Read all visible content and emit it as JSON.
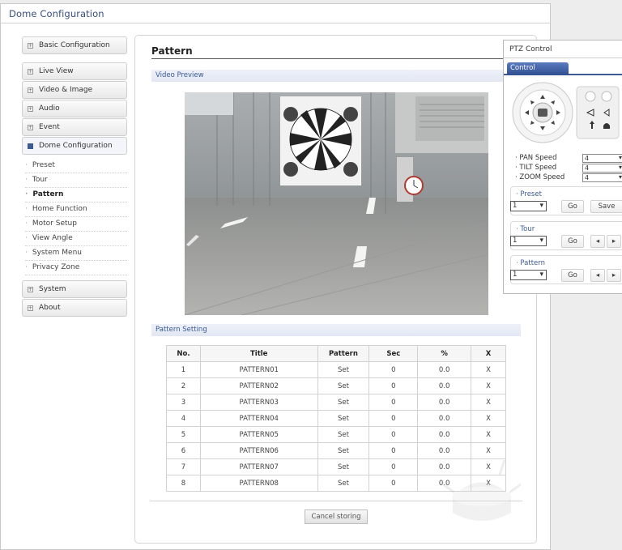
{
  "header": {
    "title": "Dome Configuration"
  },
  "sidebar": {
    "top_items": [
      {
        "label": "Basic Configuration"
      }
    ],
    "items": [
      {
        "label": "Live View"
      },
      {
        "label": "Video & Image"
      },
      {
        "label": "Audio"
      },
      {
        "label": "Event"
      },
      {
        "label": "Dome Configuration"
      }
    ],
    "submenu": [
      {
        "label": "Preset"
      },
      {
        "label": "Tour"
      },
      {
        "label": "Pattern"
      },
      {
        "label": "Home Function"
      },
      {
        "label": "Motor Setup"
      },
      {
        "label": "View Angle"
      },
      {
        "label": "System Menu"
      },
      {
        "label": "Privacy Zone"
      }
    ],
    "bottom_items": [
      {
        "label": "System"
      },
      {
        "label": "About"
      }
    ]
  },
  "page": {
    "title": "Pattern",
    "video_section": "Video Preview",
    "pattern_section": "Pattern Setting",
    "cancel_button": "Cancel storing"
  },
  "table": {
    "headers": [
      "No.",
      "Title",
      "Pattern",
      "Sec",
      "%",
      "X"
    ],
    "rows": [
      [
        "1",
        "PATTERN01",
        "Set",
        "0",
        "0.0",
        "X"
      ],
      [
        "2",
        "PATTERN02",
        "Set",
        "0",
        "0.0",
        "X"
      ],
      [
        "3",
        "PATTERN03",
        "Set",
        "0",
        "0.0",
        "X"
      ],
      [
        "4",
        "PATTERN04",
        "Set",
        "0",
        "0.0",
        "X"
      ],
      [
        "5",
        "PATTERN05",
        "Set",
        "0",
        "0.0",
        "X"
      ],
      [
        "6",
        "PATTERN06",
        "Set",
        "0",
        "0.0",
        "X"
      ],
      [
        "7",
        "PATTERN07",
        "Set",
        "0",
        "0.0",
        "X"
      ],
      [
        "8",
        "PATTERN08",
        "Set",
        "0",
        "0.0",
        "X"
      ]
    ]
  },
  "ptz": {
    "title": "PTZ Control",
    "tab": "Control",
    "pan_label": "· PAN Speed",
    "pan_value": "4",
    "tilt_label": "· TILT Speed",
    "tilt_value": "4",
    "zoom_label": "· ZOOM Speed",
    "zoom_value": "4",
    "preset": {
      "label": "· Preset",
      "value": "1",
      "go": "Go",
      "save": "Save"
    },
    "tour": {
      "label": "· Tour",
      "value": "1",
      "go": "Go",
      "prev": "◂",
      "next": "▸"
    },
    "pattern": {
      "label": "· Pattern",
      "value": "1",
      "go": "Go",
      "prev": "◂",
      "next": "▸"
    }
  },
  "colors": {
    "accent": "#3b5a96",
    "tab": "#2f4e8f",
    "title_text": "#35507f"
  }
}
